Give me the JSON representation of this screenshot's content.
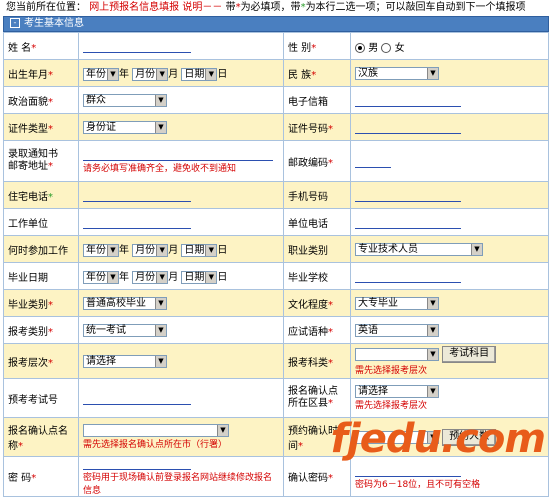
{
  "location": {
    "prefix": "您当前所在位置：",
    "crumb": "网上预报名信息填报",
    "note_label": "说明－－",
    "note_text": "带",
    "note_req": "*",
    "note_mid": "为必填项，带",
    "note_green": "*",
    "note_tail": "为本行二选一项；可以敲回车自动到下一个填报项"
  },
  "section": {
    "toggle": "⊟",
    "title": "考生基本信息"
  },
  "form": {
    "name_label": "姓 名",
    "gender_label": "性 别",
    "gender_male": "男",
    "gender_female": "女",
    "birth_label": "出生年月",
    "year_sel": "年份",
    "year_unit": "年",
    "month_sel": "月份",
    "month_unit": "月",
    "day_sel": "日期",
    "day_unit": "日",
    "nation_label": "民 族",
    "nation_value": "汉族",
    "politics_label": "政治面貌",
    "politics_value": "群众",
    "email_label": "电子信箱",
    "id_type_label": "证件类型",
    "id_type_value": "身份证",
    "id_no_label": "证件号码",
    "addr_label_1": "录取通知书",
    "addr_label_2": "邮寄地址",
    "addr_hint": "请务必填写准确齐全，避免收不到通知",
    "zip_label": "邮政编码",
    "home_phone_label": "住宅电话",
    "mobile_label": "手机号码",
    "work_unit_label": "工作单位",
    "work_phone_label": "单位电话",
    "work_start_label": "何时参加工作",
    "job_type_label": "职业类别",
    "job_type_value": "专业技术人员",
    "grad_date_label": "毕业日期",
    "grad_school_label": "毕业学校",
    "grad_type_label": "毕业类别",
    "grad_type_value": "普通高校毕业",
    "edu_label": "文化程度",
    "edu_value": "大专毕业",
    "exam_type_label": "报考类别",
    "exam_type_value": "统一考试",
    "lang_label": "应试语种",
    "lang_value": "英语",
    "level_label": "报考层次",
    "level_value": "请选择",
    "subject_label": "报考科类",
    "subject_btn": "考试科目",
    "subject_hint": "需先选择报考层次",
    "pre_no_label": "预考考试号",
    "district_label_1": "报名确认点",
    "district_label_2": "所在区县",
    "district_value": "请选择",
    "district_hint": "需先选择报考层次",
    "confirm_label": "报名确认点名称",
    "confirm_hint": "需先选择报名确认点所在市（行署）",
    "appt_label": "预约确认时间",
    "appt_btn": "预约人数",
    "pwd_label": "密 码",
    "pwd_hint": "密码用于现场确认前登录报名网站继续修改报名信息",
    "pwd2_label": "确认密码",
    "pwd2_hint": "密码为6－18位，且不可有空格",
    "req_mark": "*",
    "green_mark": "*"
  },
  "watermark": "fjedu.com",
  "colors": {
    "header_bar": "#4a7fc0",
    "row_yellow": "#fdf3c4",
    "required": "#d40000",
    "watermark": "#e85c1a"
  }
}
